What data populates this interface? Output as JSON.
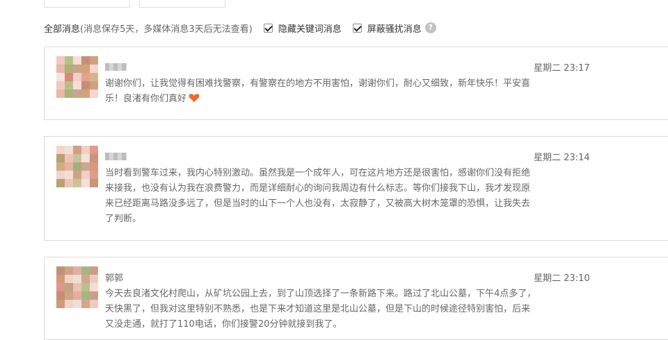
{
  "filter": {
    "title": "全部消息",
    "note": "(消息保存5天，多媒体消息3天后无法查看)",
    "options": [
      {
        "label": "隐藏关键词消息",
        "checked": true
      },
      {
        "label": "屏蔽骚扰消息",
        "checked": true
      }
    ],
    "help_icon": "?"
  },
  "messages": [
    {
      "name": "",
      "name_masked": true,
      "time": "星期二 23:17",
      "text": "谢谢你们，让我觉得有困难找警察，有警察在的地方不用害怕，谢谢你们，耐心又细致，新年快乐！平安喜乐！良渚有你们真好",
      "emoji": "heart"
    },
    {
      "name": "",
      "name_masked": true,
      "time": "星期二 23:14",
      "text": "当时看到警车过来，我内心特别激动。虽然我是一个成年人，可在这片地方还是很害怕，感谢你们没有拒绝来接我，也没有认为我在浪费警力，而是详细耐心的询问我周边有什么标志。等你们接我下山，我才发现原来已经距离马路没多远了，但是当时的山下一个人也没有，太寂静了，又被高大树木笼罩的恐惧，让我失去了判断。"
    },
    {
      "name": "郭郭",
      "name_masked": false,
      "time": "星期二 23:10",
      "text": "今天去良渚文化村爬山，从矿坑公园上去，到了山顶选择了一条新路下来。路过了北山公墓，下午4点多了，天快黑了，但我对这里特别不熟悉，也是下来才知道这里是北山公墓，但是下山的时候途径特别害怕，后来又没走通，就打了110电话，你们接警20分钟就接到我了。"
    }
  ]
}
